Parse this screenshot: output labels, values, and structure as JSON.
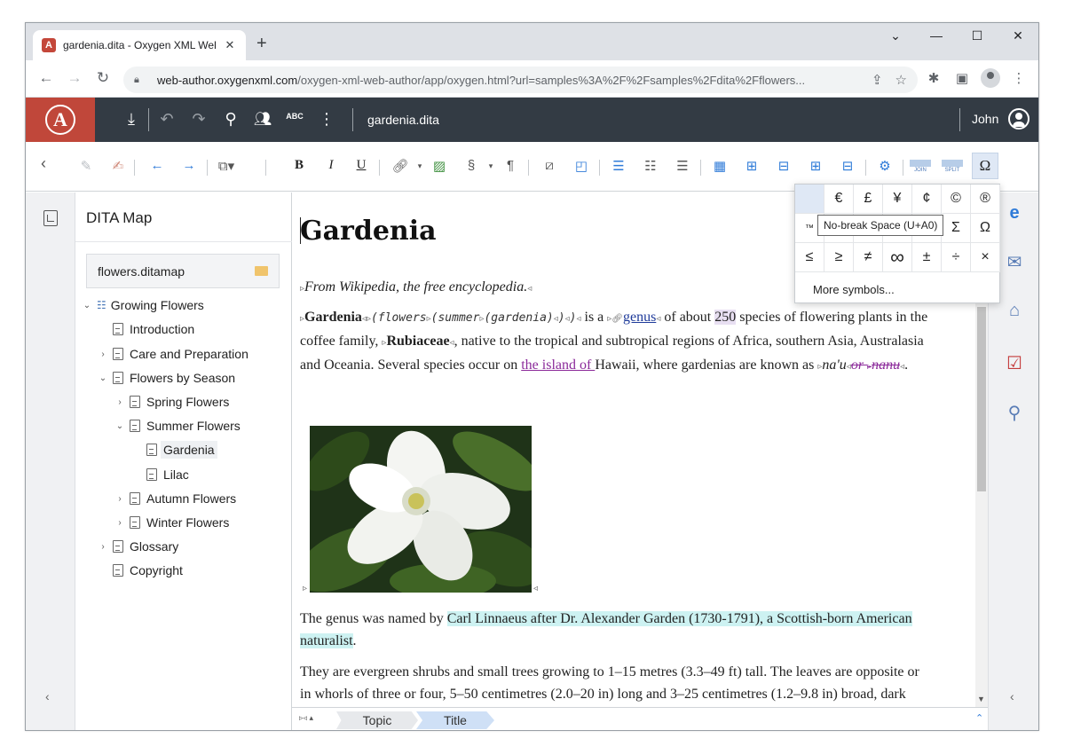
{
  "browser": {
    "tab_title": "gardenia.dita - Oxygen XML Wel",
    "tab_favicon_letter": "A",
    "close_glyph": "✕",
    "new_tab_glyph": "+",
    "url_host": "web-author.oxygenxml.com",
    "url_path": "/oxygen-xml-web-author/app/oxygen.html?url=samples%3A%2F%2Fsamples%2Fdita%2Fflowers...",
    "window_controls": {
      "minimize": "—",
      "maximize": "☐",
      "close": "✕",
      "dropdown": "⌄"
    }
  },
  "app": {
    "logo_letter": "A",
    "document_name": "gardenia.dita",
    "user_name": "John",
    "spell_label": "ABC"
  },
  "toolbar": {
    "bold": "B",
    "italic": "I",
    "underline": "U",
    "section": "§",
    "pilcrow": "¶",
    "join_label": "JOIN",
    "split_label": "SPLIT",
    "omega": "Ω"
  },
  "dita_map": {
    "title": "DITA Map",
    "file": "flowers.ditamap",
    "items": [
      {
        "label": "Growing Flowers",
        "chevron": "⌄"
      },
      {
        "label": "Introduction",
        "chevron": ""
      },
      {
        "label": "Care and Preparation",
        "chevron": "›"
      },
      {
        "label": "Flowers by Season",
        "chevron": "⌄"
      },
      {
        "label": "Spring Flowers",
        "chevron": "›"
      },
      {
        "label": "Summer Flowers",
        "chevron": "⌄"
      },
      {
        "label": "Gardenia",
        "chevron": ""
      },
      {
        "label": "Lilac",
        "chevron": ""
      },
      {
        "label": "Autumn Flowers",
        "chevron": "›"
      },
      {
        "label": "Winter Flowers",
        "chevron": "›"
      },
      {
        "label": "Glossary",
        "chevron": "›"
      },
      {
        "label": "Copyright",
        "chevron": ""
      }
    ]
  },
  "editor": {
    "heading": "Gardenia",
    "shortdesc": "From Wikipedia, the free encyclopedia.",
    "p1": {
      "term": "Gardenia",
      "code": "(flowers",
      "code2": "(summer",
      "code3": "(gardenia)",
      "code_end": ")",
      "t1": " is a ",
      "link_genus": "genus",
      "t2": " of about ",
      "num": "250",
      "t3": " species of flowering plants in the coffee family, ",
      "family": "Rubiaceae",
      "t4": ", native to the tropical and subtropical regions of Africa, southern Asia, Australasia and Oceania. Several species occur on ",
      "link_island": "the island of ",
      "t5": "Hawaii, where gardenias are known as ",
      "local1": "na'u",
      "or_text": "or ",
      "local2": "nanu",
      "t6": "."
    },
    "p2": {
      "t1": "The genus was named by ",
      "highlight": "Carl Linnaeus after Dr. Alexander Garden (1730-1791), a Scottish-born American naturalist",
      "t2": "."
    },
    "p3": "They are evergreen shrubs and small trees growing to 1–15 metres (3.3–49 ft) tall. The leaves are opposite or in whorls of three or four, 5–50 centimetres (2.0–20 in) long and 3–25 centimetres (1.2–9.8 in) broad, dark green and glossy with a leathery texture. The flowers are solitary or in small"
  },
  "breadcrumb": {
    "items": [
      "Topic",
      "Title"
    ]
  },
  "symbols": {
    "row1": [
      "",
      "€",
      "£",
      "¥",
      "¢",
      "©",
      "®"
    ],
    "row2": [
      "™",
      "",
      "",
      "",
      "",
      "Σ",
      "Ω"
    ],
    "row3": [
      "≤",
      "≥",
      "≠",
      "∞",
      "±",
      "÷",
      "×"
    ],
    "more": "More symbols...",
    "tooltip": "No-break Space (U+A0)"
  }
}
